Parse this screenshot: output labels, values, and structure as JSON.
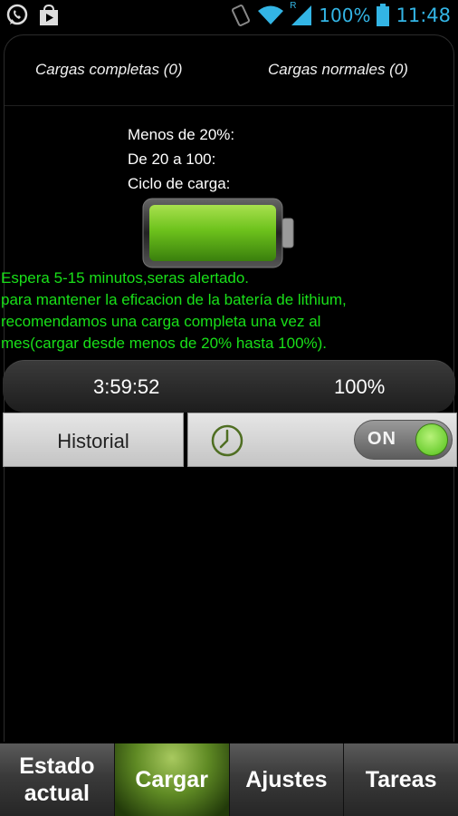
{
  "status_bar": {
    "left_icons": [
      "whatsapp-icon",
      "play-store-icon"
    ],
    "battery_percent": "100%",
    "time": "11:48",
    "accent_color": "#33b5e5",
    "roaming_indicator": "R"
  },
  "counters": {
    "full_charges": "Cargas completas (0)",
    "normal_charges": "Cargas normales (0)"
  },
  "info": {
    "line1": "Menos de 20%:",
    "line2": "De 20 a 100:",
    "line3": "Ciclo de carga:"
  },
  "battery_level": 1.0,
  "message": {
    "line1": "Espera 5-15 minutos,seras alertado.",
    "line2": "para mantener la eficacion de la batería de lithium,",
    "line3": "recomendamos una carga completa una vez al",
    "line4": "mes(cargar desde menos de 20% hasta 100%).",
    "color": "#19e019"
  },
  "readout": {
    "time": "3:59:52",
    "percent": "100%"
  },
  "history_button": "Historial",
  "toggle": {
    "label": "ON",
    "state": "on"
  },
  "tabs": [
    {
      "line1": "Estado",
      "line2": "actual"
    },
    {
      "line1": "Cargar"
    },
    {
      "line1": "Ajustes"
    },
    {
      "line1": "Tareas"
    }
  ],
  "active_tab": "Cargar"
}
